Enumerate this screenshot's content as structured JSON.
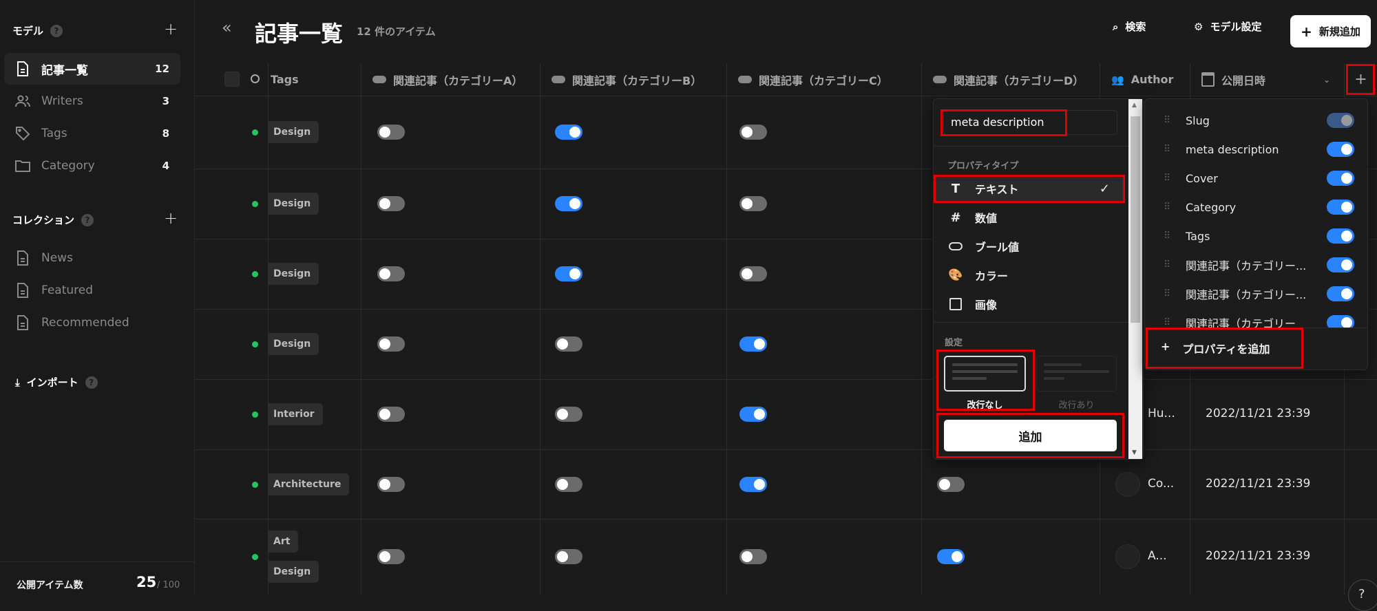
{
  "sidebar": {
    "models_title": "モデル",
    "help": "?",
    "add": "+",
    "models": [
      {
        "label": "記事一覧",
        "count": "12",
        "icon": "document-icon",
        "active": true
      },
      {
        "label": "Writers",
        "count": "3",
        "icon": "users-icon"
      },
      {
        "label": "Tags",
        "count": "8",
        "icon": "tag-icon"
      },
      {
        "label": "Category",
        "count": "4",
        "icon": "folder-icon"
      }
    ],
    "collections_title": "コレクション",
    "collections": [
      {
        "label": "News",
        "icon": "document-icon"
      },
      {
        "label": "Featured",
        "icon": "document-icon"
      },
      {
        "label": "Recommended",
        "icon": "document-icon"
      }
    ],
    "import_label": "インポート",
    "published_label": "公開アイテム数",
    "published_count": "25",
    "published_limit": "/ 100"
  },
  "header": {
    "title": "記事一覧",
    "subtitle": "12 件のアイテム",
    "search": "検索",
    "model_settings": "モデル設定",
    "new_item": "新規追加"
  },
  "table": {
    "columns": [
      "Tags",
      "関連記事（カテゴリーA）",
      "関連記事（カテゴリーB）",
      "関連記事（カテゴリーC）",
      "関連記事（カテゴリーD）",
      "Author",
      "公開日時"
    ],
    "add_column": "+",
    "rows": [
      {
        "tags": [
          "Design"
        ],
        "a": false,
        "b": true,
        "c": false
      },
      {
        "tags": [
          "Design"
        ],
        "a": false,
        "b": true,
        "c": false
      },
      {
        "tags": [
          "Design"
        ],
        "a": false,
        "b": true,
        "c": false
      },
      {
        "tags": [
          "Design"
        ],
        "a": false,
        "b": false,
        "c": true
      },
      {
        "tags": [
          "Interior"
        ],
        "a": false,
        "b": false,
        "c": true,
        "author": "Hu...",
        "date": "2022/11/21 23:39"
      },
      {
        "tags": [
          "Architecture"
        ],
        "a": false,
        "b": false,
        "c": true,
        "d": false,
        "author": "Co...",
        "date": "2022/11/21 23:39"
      },
      {
        "tags": [
          "Art",
          "Design"
        ],
        "a": false,
        "b": false,
        "c": false,
        "d": true,
        "author": "A...",
        "date": "2022/11/21 23:39"
      }
    ]
  },
  "new_property": {
    "name_value": "meta description",
    "type_label": "プロパティタイプ",
    "types": [
      {
        "label": "テキスト",
        "icon": "text-icon",
        "selected": true
      },
      {
        "label": "数値",
        "icon": "hash-icon"
      },
      {
        "label": "ブール値",
        "icon": "toggle-icon"
      },
      {
        "label": "カラー",
        "icon": "palette-icon"
      },
      {
        "label": "画像",
        "icon": "image-icon"
      }
    ],
    "settings_label": "設定",
    "option_no_wrap": "改行なし",
    "option_wrap": "改行あり",
    "add_button": "追加"
  },
  "property_list": {
    "items": [
      {
        "label": "Slug",
        "on": "disabled"
      },
      {
        "label": "meta description",
        "on": true
      },
      {
        "label": "Cover",
        "on": true
      },
      {
        "label": "Category",
        "on": true
      },
      {
        "label": "Tags",
        "on": true
      },
      {
        "label": "関連記事（カテゴリー...",
        "on": true
      },
      {
        "label": "関連記事（カテゴリー...",
        "on": true
      },
      {
        "label": "関連記事（カテゴリー",
        "on": true
      }
    ],
    "add_property": "プロパティを追加"
  },
  "colors": {
    "accent": "#2b84ff",
    "status_published": "#22c55e",
    "highlight": "#e00000"
  }
}
